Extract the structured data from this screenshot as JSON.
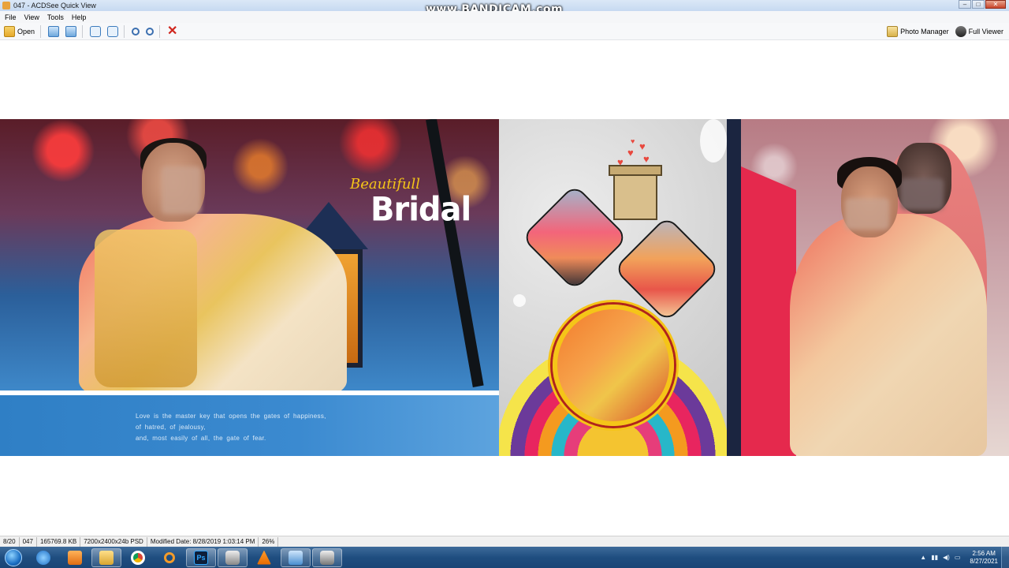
{
  "window": {
    "title": "047 - ACDSee Quick View",
    "watermark": "www.BANDICAM.com",
    "controls": [
      "–",
      "□",
      "✕"
    ]
  },
  "menu": {
    "items": [
      "File",
      "View",
      "Tools",
      "Help"
    ]
  },
  "toolbar": {
    "open_label": "Open",
    "photo_manager_label": "Photo Manager",
    "full_viewer_label": "Full Viewer",
    "icons": [
      "open-icon",
      "previous-icon",
      "next-icon",
      "rotate-left-icon",
      "rotate-right-icon",
      "zoom-in-icon",
      "zoom-out-icon",
      "delete-icon"
    ]
  },
  "album": {
    "script_title": "Beautifull",
    "main_title": "Bridal",
    "quote_lines": [
      "Love is the master key that opens the gates of happiness,",
      "of hatred, of jealousy,",
      "and, most easily of all, the gate of fear."
    ],
    "colors": {
      "title_gold": "#f5c518",
      "quote_band": "#3b8ad0",
      "accent_red": "#e5294d",
      "navy": "#1b2540"
    }
  },
  "statusbar": {
    "cells": [
      "8/20",
      "047",
      "165769.8 KB",
      "7200x2400x24b PSD",
      "Modified Date: 8/28/2019 1:03:14 PM",
      "26%"
    ]
  },
  "taskbar": {
    "apps": [
      "internet-explorer-icon",
      "media-player-icon",
      "file-explorer-icon",
      "chrome-icon",
      "search-icon",
      "photoshop-icon",
      "acdsee-icon",
      "vlc-icon",
      "image-viewer-icon",
      "acdsee-icon"
    ],
    "photoshop_label": "Ps",
    "clock_time": "2:56 AM",
    "clock_date": "8/27/2021",
    "tray_arrow": "▲"
  }
}
